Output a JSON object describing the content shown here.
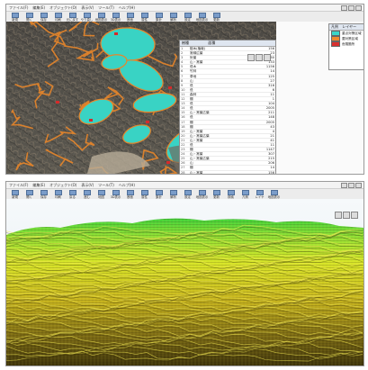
{
  "window1": {
    "menu": [
      "ファイル(F)",
      "編集(E)",
      "オブジェクト(O)",
      "表示(V)",
      "ツール(T)",
      "ヘルプ(H)"
    ],
    "toolbar": [
      "新規",
      "開く",
      "保存",
      "印刷",
      "元に戻す",
      "やり直し",
      "地図表示",
      "3D表示",
      "断面",
      "属性",
      "集計",
      "解析",
      "設定",
      "地図表示",
      "更新"
    ],
    "table": {
      "header": [
        "",
        "樹種",
        "面積"
      ],
      "rows": [
        [
          "1",
          "樹木(植栽)",
          "156"
        ],
        [
          "2",
          "常緑広葉",
          "23"
        ],
        [
          "3",
          "針葉",
          "1560"
        ],
        [
          "4",
          "山・常葉",
          "133"
        ],
        [
          "5",
          "低木",
          "1156"
        ],
        [
          "6",
          "竹林",
          "14"
        ],
        [
          "7",
          "草地",
          "125"
        ],
        [
          "8",
          "山",
          "27"
        ],
        [
          "9",
          "低",
          "316"
        ],
        [
          "10",
          "低",
          "6"
        ],
        [
          "11",
          "森林",
          "11"
        ],
        [
          "12",
          "棚",
          "1"
        ],
        [
          "13",
          "低",
          "104"
        ],
        [
          "14",
          "低",
          "2005"
        ],
        [
          "15",
          "山・常葉広葉",
          "211"
        ],
        [
          "16",
          "低",
          "148"
        ],
        [
          "17",
          "棚",
          "2005"
        ],
        [
          "18",
          "棚",
          "43"
        ],
        [
          "19",
          "山・常葉",
          "4"
        ],
        [
          "20",
          "山・常葉広葉",
          "21"
        ],
        [
          "21",
          "山・常葉",
          "41"
        ],
        [
          "22",
          "低",
          "11"
        ],
        [
          "23",
          "棚",
          "1147"
        ],
        [
          "24",
          "山・常葉",
          "307"
        ],
        [
          "25",
          "山・常葉広葉",
          "215"
        ],
        [
          "26",
          "山",
          "206"
        ],
        [
          "27",
          "棚",
          "14"
        ],
        [
          "28",
          "山・常葉",
          "156"
        ],
        [
          "29",
          "草地",
          "313"
        ],
        [
          "30",
          "低",
          "17"
        ],
        [
          "31",
          "樹",
          "2126"
        ],
        [
          "32",
          "山林",
          "205"
        ],
        [
          "33",
          "竹林",
          "44"
        ],
        [
          "34",
          "棚",
          "312"
        ],
        [
          "35",
          "山",
          "6"
        ]
      ]
    },
    "legend": {
      "title": "凡例",
      "tab": "レイヤー",
      "items": [
        {
          "label": "重点対策区域",
          "color": "#3ad6c8"
        },
        {
          "label": "要対策区域",
          "color": "#f08a2c"
        },
        {
          "label": "危険箇所",
          "color": "#d83030"
        }
      ]
    }
  },
  "window2": {
    "menu": [
      "ファイル(F)",
      "編集(E)",
      "オブジェクト(O)",
      "表示(V)",
      "ツール(T)",
      "ヘルプ(H)"
    ],
    "toolbar": [
      "新規",
      "開く",
      "保存",
      "印刷",
      "戻る",
      "進む",
      "地図",
      "3D表示",
      "断面",
      "属性",
      "集計",
      "解析",
      "設定",
      "地図表示",
      "更新",
      "検索",
      "凡例",
      "レイヤ",
      "地図表示"
    ]
  }
}
